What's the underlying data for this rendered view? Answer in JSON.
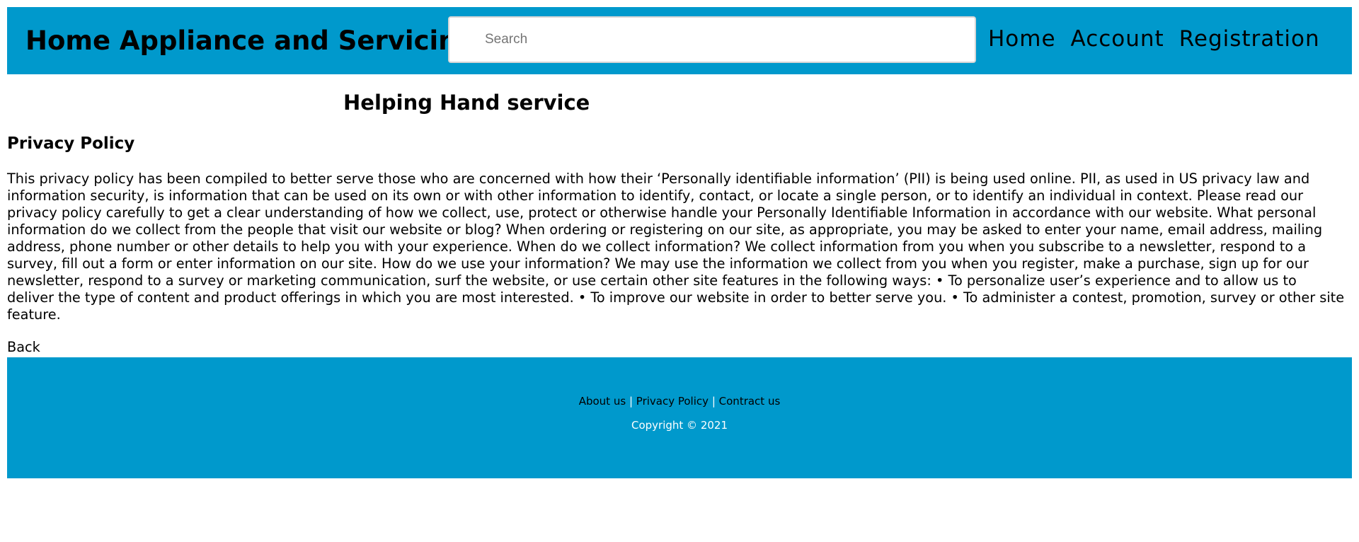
{
  "header": {
    "site_title": "Home Appliance and Servicing",
    "search": {
      "placeholder": "Search",
      "value": ""
    },
    "nav": [
      {
        "label": "Home"
      },
      {
        "label": "Account"
      },
      {
        "label": "Registration"
      }
    ]
  },
  "main": {
    "heading": "Helping Hand service",
    "section_title": "Privacy Policy",
    "body": "This privacy policy has been compiled to better serve those who are concerned with how their ‘Personally identifiable information’ (PII) is being used online. PII, as used in US privacy law and information security, is information that can be used on its own or with other information to identify, contact, or locate a single person, or to identify an individual in context. Please read our privacy policy carefully to get a clear understanding of how we collect, use, protect or otherwise handle your Personally Identifiable Information in accordance with our website. What personal information do we collect from the people that visit our website or blog? When ordering or registering on our site, as appropriate, you may be asked to enter your name, email address, mailing address, phone number or other details to help you with your experience. When do we collect information? We collect information from you when you subscribe to a newsletter, respond to a survey, fill out a form or enter information on our site. How do we use your information? We may use the information we collect from you when you register, make a purchase, sign up for our newsletter, respond to a survey or marketing communication, surf the website, or use certain other site features in the following ways: • To personalize user’s experience and to allow us to deliver the type of content and product offerings in which you are most interested. • To improve our website in order to better serve you. • To administer a contest, promotion, survey or other site feature.",
    "back_label": "Back"
  },
  "footer": {
    "links": [
      {
        "label": "About us"
      },
      {
        "label": "Privacy Policy"
      },
      {
        "label": "Contract us"
      }
    ],
    "separator": "|",
    "copyright": "Copyright © 2021"
  },
  "colors": {
    "header_bg": "#0099cc",
    "footer_bg": "#0099cc",
    "footer_text": "#ffffff"
  }
}
